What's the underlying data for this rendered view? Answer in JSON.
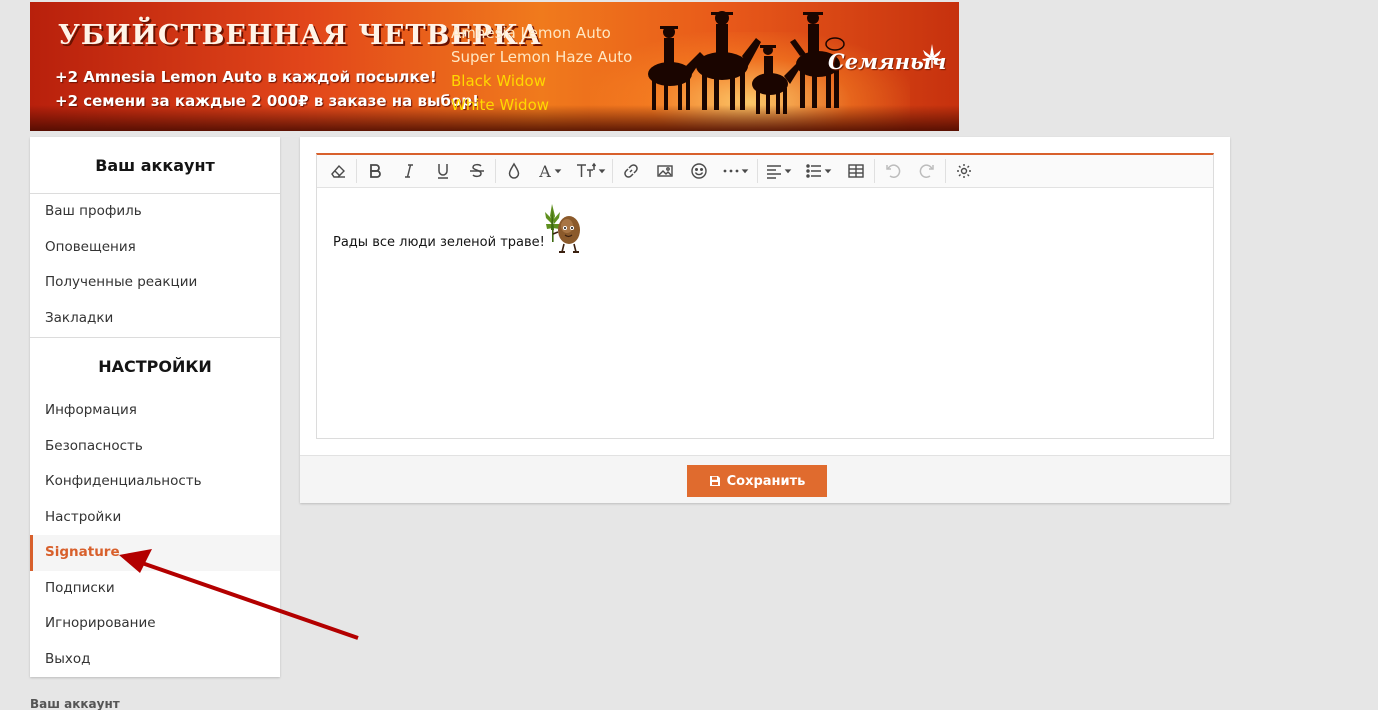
{
  "banner": {
    "title": "УБИЙСТВЕННАЯ ЧЕТВЕРКА",
    "line1": "+2 Amnesia Lemon Auto в каждой посылке!",
    "line2": "+2 семени за каждые 2 000₽ в заказе на выбор!",
    "strains": [
      {
        "name": "Amnesia Lemon Auto",
        "color": "#ffe7c2"
      },
      {
        "name": "Super Lemon Haze Auto",
        "color": "#ffe7c2"
      },
      {
        "name": "Black Widow",
        "color": "#ffd800"
      },
      {
        "name": "White Widow",
        "color": "#ffd800"
      }
    ],
    "brand": "Семяныч"
  },
  "sidebar": {
    "account_heading": "Ваш аккаунт",
    "account_items": [
      {
        "label": "Ваш профиль"
      },
      {
        "label": "Оповещения"
      },
      {
        "label": "Полученные реакции"
      },
      {
        "label": "Закладки"
      }
    ],
    "settings_heading": "НАСТРОЙКИ",
    "settings_items": [
      {
        "label": "Информация"
      },
      {
        "label": "Безопасность"
      },
      {
        "label": "Конфиденциальность"
      },
      {
        "label": "Настройки"
      },
      {
        "label": "Signature",
        "active": true
      },
      {
        "label": "Подписки"
      },
      {
        "label": "Игнорирование"
      },
      {
        "label": "Выход"
      }
    ]
  },
  "footer": {
    "breadcrumb": "Ваш аккаунт"
  },
  "editor": {
    "toolbar": [
      "eraser-icon",
      "bold-icon",
      "italic-icon",
      "underline-icon",
      "strikethrough-icon",
      "color-icon",
      "font-family-icon",
      "font-size-icon",
      "link-icon",
      "image-icon",
      "smilie-icon",
      "more-icon",
      "align-icon",
      "list-icon",
      "table-icon",
      "undo-icon",
      "redo-icon",
      "settings-icon"
    ],
    "content_text": "Рады все люди зеленой траве!"
  },
  "save_button": {
    "label": "Сохранить"
  },
  "colors": {
    "accent": "#d8602c",
    "button": "#e06b2e",
    "arrow": "#b30000"
  }
}
